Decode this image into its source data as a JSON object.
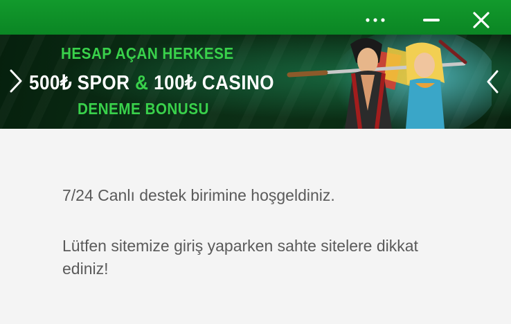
{
  "header": {
    "background_color": "#0f8f28",
    "more_icon": "more-horizontal-icon",
    "minimize_icon": "minimize-icon",
    "close_icon": "close-icon"
  },
  "banner": {
    "line1": "HESAP AÇAN HERKESE",
    "line2_part1": "500₺ SPOR ",
    "line2_amp": "&",
    "line2_part2": " 100₺ CASINO",
    "line3": "DENEME BONUSU",
    "accent_color": "#39d14b",
    "prev_icon": "chevron-left-icon",
    "next_icon": "chevron-right-icon"
  },
  "chat": {
    "messages": [
      "7/24 Canlı destek birimine hoşgeldiniz.",
      "Lütfen sitemize giriş yaparken sahte sitelere dikkat ediniz!"
    ],
    "text_color": "#5a5a5a",
    "background_color": "#f4f4f4"
  }
}
